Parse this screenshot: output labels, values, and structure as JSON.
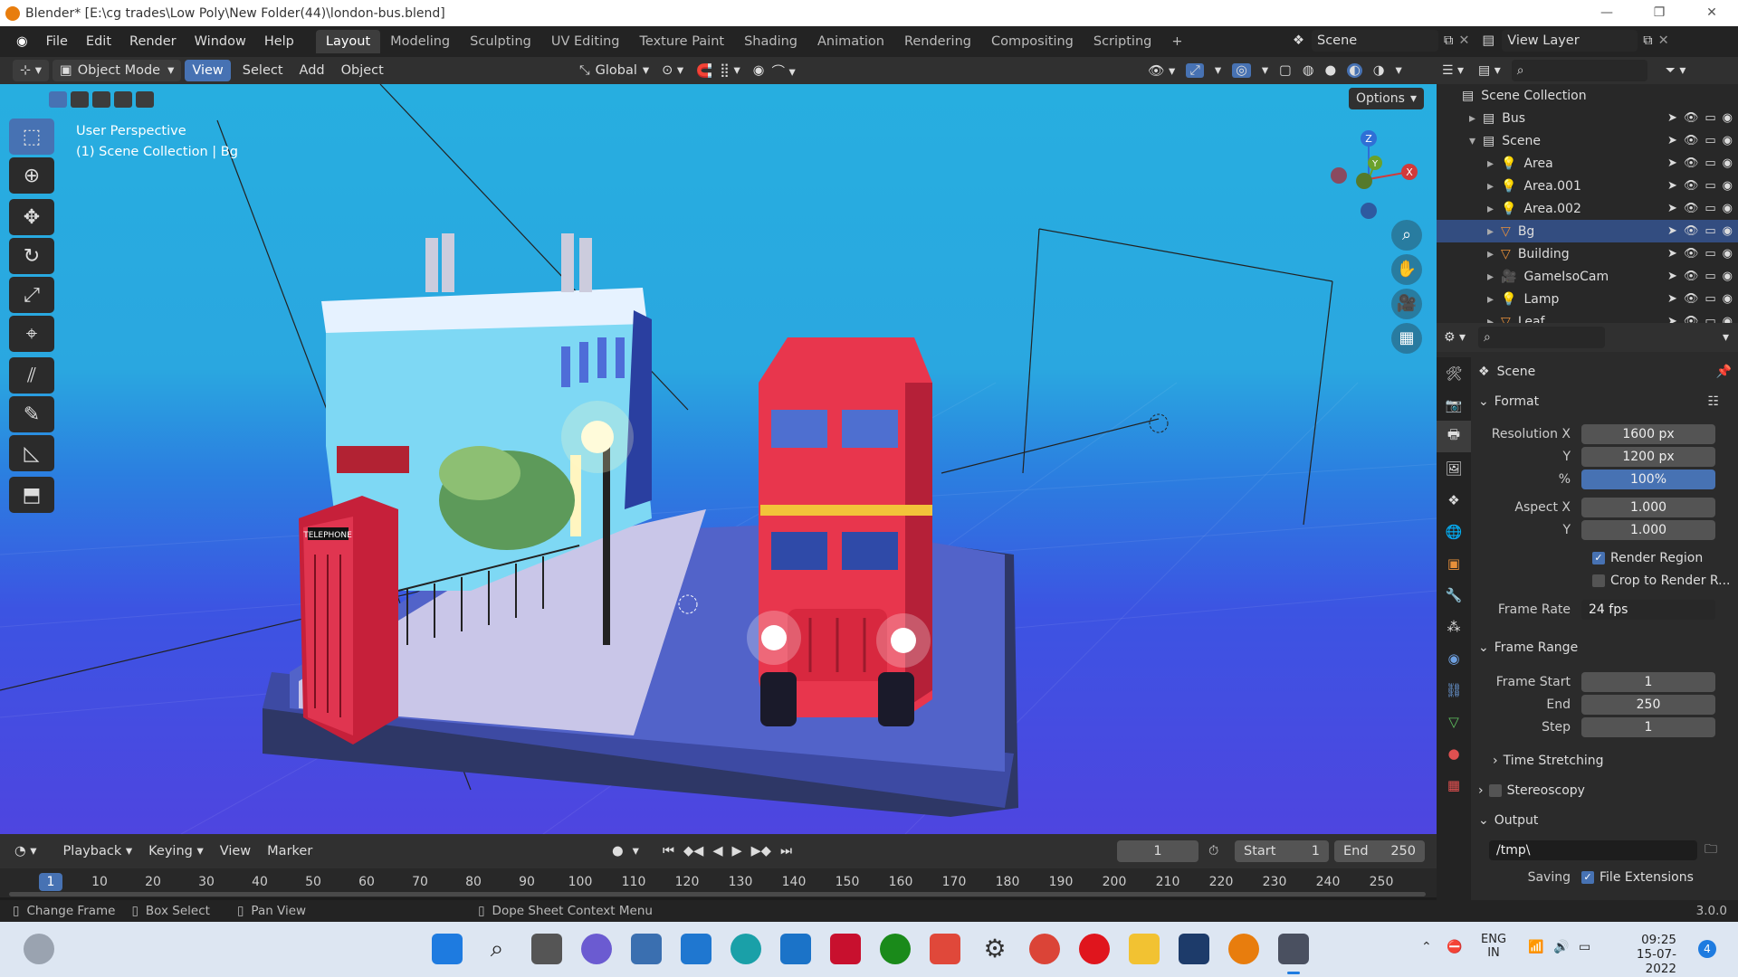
{
  "titlebar": {
    "text": "Blender* [E:\\cg trades\\Low Poly\\New Folder(44)\\london-bus.blend]",
    "minimize": "—",
    "maximize": "❐",
    "close": "✕"
  },
  "menu": [
    "File",
    "Edit",
    "Render",
    "Window",
    "Help"
  ],
  "workspaces": [
    "Layout",
    "Modeling",
    "Sculpting",
    "UV Editing",
    "Texture Paint",
    "Shading",
    "Animation",
    "Rendering",
    "Compositing",
    "Scripting",
    "+"
  ],
  "scene_name": "Scene",
  "view_layer": "View Layer",
  "viewport_header": {
    "mode": "Object Mode",
    "menus": [
      "View",
      "Select",
      "Add",
      "Object"
    ],
    "orientation": "Global",
    "options": "Options"
  },
  "viewport": {
    "line1": "User Perspective",
    "line2": "(1) Scene Collection | Bg"
  },
  "gizmo": {
    "z": "Z",
    "y": "Y",
    "x": "X"
  },
  "outliner": {
    "root": "Scene Collection",
    "rows": [
      {
        "name": "Bus",
        "indent": 1,
        "sel": false
      },
      {
        "name": "Scene",
        "indent": 1,
        "sel": false
      },
      {
        "name": "Area",
        "indent": 2,
        "sel": false
      },
      {
        "name": "Area.001",
        "indent": 2,
        "sel": false
      },
      {
        "name": "Area.002",
        "indent": 2,
        "sel": false
      },
      {
        "name": "Bg",
        "indent": 2,
        "sel": true
      },
      {
        "name": "Building",
        "indent": 2,
        "sel": false
      },
      {
        "name": "GameIsoCam",
        "indent": 2,
        "sel": false
      },
      {
        "name": "Lamp",
        "indent": 2,
        "sel": false
      },
      {
        "name": "Leaf",
        "indent": 2,
        "sel": false
      }
    ]
  },
  "properties": {
    "context": "Scene",
    "format": "Format",
    "res_x_label": "Resolution X",
    "res_x": "1600 px",
    "res_y_label": "Y",
    "res_y": "1200 px",
    "pct_label": "%",
    "pct": "100%",
    "aspect_x_label": "Aspect X",
    "aspect_x": "1.000",
    "aspect_y_label": "Y",
    "aspect_y": "1.000",
    "render_region": "Render Region",
    "crop": "Crop to Render R...",
    "frame_rate_label": "Frame Rate",
    "frame_rate": "24 fps",
    "frame_range": "Frame Range",
    "frame_start_label": "Frame Start",
    "frame_start": "1",
    "end_label": "End",
    "end": "250",
    "step_label": "Step",
    "step": "1",
    "time_stretching": "Time Stretching",
    "stereoscopy": "Stereoscopy",
    "output": "Output",
    "output_path": "/tmp\\",
    "saving": "Saving",
    "file_ext": "File Extensions"
  },
  "timeline": {
    "menus": [
      "Playback",
      "Keying",
      "View",
      "Marker"
    ],
    "current": "1",
    "start_label": "Start",
    "start": "1",
    "end_label": "End",
    "end": "250",
    "ticks": [
      "1",
      "10",
      "20",
      "30",
      "40",
      "50",
      "60",
      "70",
      "80",
      "90",
      "100",
      "110",
      "120",
      "130",
      "140",
      "150",
      "160",
      "170",
      "180",
      "190",
      "200",
      "210",
      "220",
      "230",
      "240",
      "250"
    ]
  },
  "status": {
    "change_frame": "Change Frame",
    "box_select": "Box Select",
    "pan_view": "Pan View",
    "context_menu": "Dope Sheet Context Menu",
    "version": "3.0.0"
  },
  "taskbar": {
    "lang1": "ENG",
    "lang2": "IN",
    "time": "09:25",
    "date": "15-07-2022",
    "badge": "4"
  },
  "telephone_sign": "TELEPHONE"
}
